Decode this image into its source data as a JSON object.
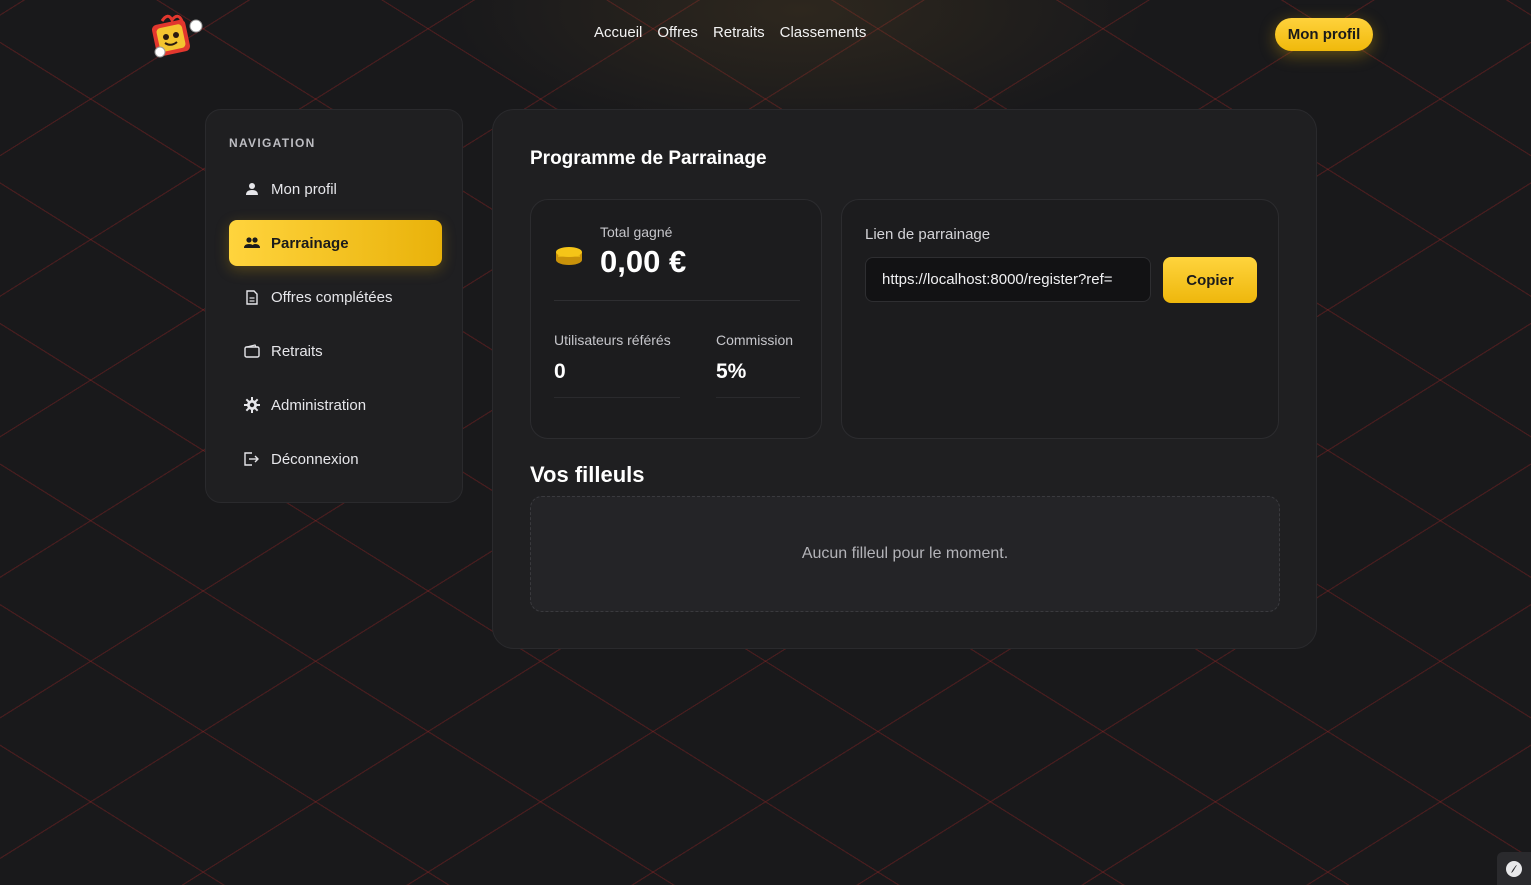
{
  "header": {
    "logo_icon": "gift-mascot-logo",
    "nav": [
      "Accueil",
      "Offres",
      "Retraits",
      "Classements"
    ],
    "profile_button": "Mon profil",
    "accent_color": "#f5c518"
  },
  "sidebar": {
    "title": "NAVIGATION",
    "items": [
      {
        "label": "Mon profil",
        "icon": "user-icon",
        "active": false
      },
      {
        "label": "Parrainage",
        "icon": "users-icon",
        "active": true
      },
      {
        "label": "Offres complétées",
        "icon": "document-icon",
        "active": false
      },
      {
        "label": "Retraits",
        "icon": "wallet-icon",
        "active": false
      },
      {
        "label": "Administration",
        "icon": "gear-icon",
        "active": false
      },
      {
        "label": "Déconnexion",
        "icon": "logout-icon",
        "active": false
      }
    ]
  },
  "main": {
    "title": "Programme de Parrainage",
    "stats": {
      "total_label": "Total gagné",
      "total_value": "0,00 €",
      "referred_label": "Utilisateurs référés",
      "referred_value": "0",
      "commission_label": "Commission",
      "commission_value": "5%"
    },
    "link": {
      "label": "Lien de parrainage",
      "value": "https://localhost:8000/register?ref=",
      "copy_button": "Copier"
    },
    "filleuls": {
      "title": "Vos filleuls",
      "empty_message": "Aucun filleul pour le moment."
    }
  }
}
